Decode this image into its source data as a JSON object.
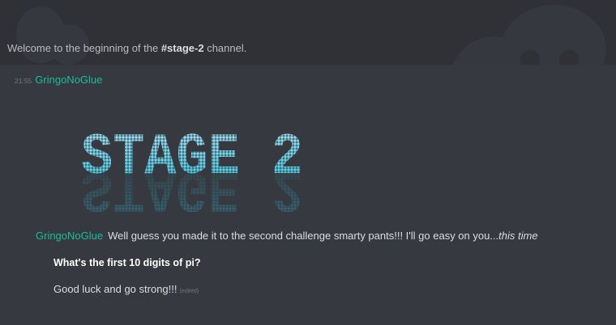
{
  "channel_welcome": {
    "prefix": "Welcome to the beginning of the ",
    "channel": "#stage-2",
    "suffix": " channel."
  },
  "messages": [
    {
      "timestamp": "21:55",
      "author": "GringoNoGlue",
      "image_text": "STAGE 2"
    },
    {
      "author": "GringoNoGlue",
      "text": "Well guess you made it to the second challenge smarty pants!!! I'll go easy on you...",
      "text_italic": "this time",
      "question": "What's the first 10 digits of pi?",
      "closing": "Good luck and go strong!!!",
      "edited_tag": "(edited)"
    }
  ],
  "colors": {
    "background": "#36393f",
    "header_band": "#2f3136",
    "username": "#1abc9c",
    "text": "#dcddde",
    "muted": "#72767d",
    "stage_top": "#ace3f8",
    "stage_bottom": "#2fc9e4"
  }
}
